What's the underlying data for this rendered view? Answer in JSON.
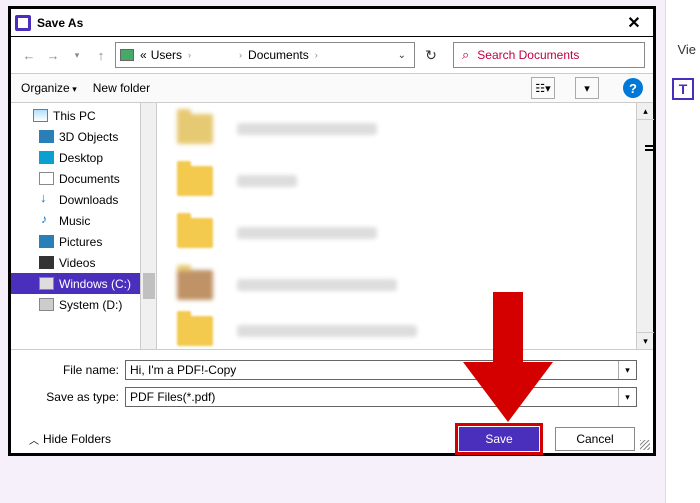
{
  "bg": {
    "vie": "Vie",
    "t": "T"
  },
  "title": "Save As",
  "breadcrumb": {
    "root": "«",
    "item1": "Users",
    "item2": "Documents",
    "sep": "›"
  },
  "search": {
    "placeholder": "Search Documents"
  },
  "toolbar": {
    "organize": "Organize",
    "newfolder": "New folder"
  },
  "tree": {
    "thispc": "This PC",
    "objects3d": "3D Objects",
    "desktop": "Desktop",
    "documents": "Documents",
    "downloads": "Downloads",
    "music": "Music",
    "pictures": "Pictures",
    "videos": "Videos",
    "windowsc": "Windows (C:)",
    "systemd": "System (D:)"
  },
  "form": {
    "filename_label": "File name:",
    "filename_value": "Hi, I'm a PDF!-Copy",
    "savetype_label": "Save as type:",
    "savetype_value": "PDF Files(*.pdf)"
  },
  "buttons": {
    "hide": "Hide Folders",
    "save": "Save",
    "cancel": "Cancel"
  },
  "help": "?"
}
